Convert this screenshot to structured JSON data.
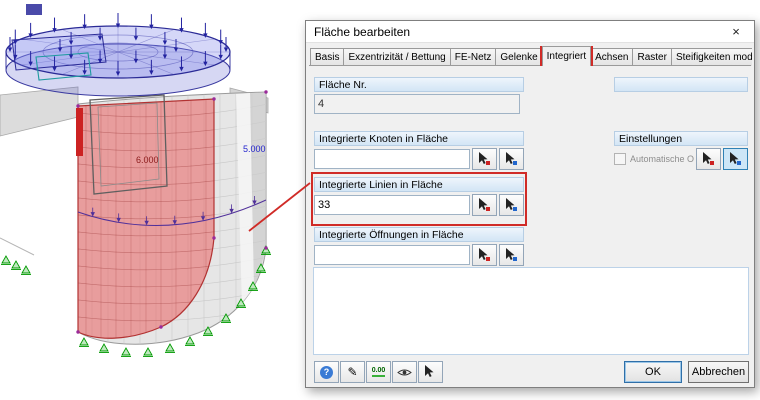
{
  "window": {
    "title": "Fläche bearbeiten",
    "close_glyph": "×"
  },
  "tabs": [
    "Basis",
    "Exzentrizität / Bettung",
    "FE-Netz",
    "Gelenke",
    "Integriert",
    "Achsen",
    "Raster",
    "Steifigkeiten modifizieren"
  ],
  "groups": {
    "surface_no": {
      "label": "Fläche Nr.",
      "value": "4"
    },
    "nodes": {
      "label": "Integrierte Knoten in Fläche",
      "value": ""
    },
    "lines": {
      "label": "Integrierte Linien in Fläche",
      "value": "33"
    },
    "openings": {
      "label": "Integrierte Öffnungen in Fläche",
      "value": ""
    },
    "settings": {
      "label": "Einstellungen",
      "auto_detection_label": "Automatische Objekterkennung",
      "auto_detection_checked": false
    }
  },
  "footer": {
    "ok": "OK",
    "cancel": "Abbrechen",
    "decimals_label": "0.00",
    "help_glyph": "?",
    "edit_glyph": "✎"
  },
  "model": {
    "dim_6": "6.000",
    "dim_5": "5.000"
  },
  "annotation_color": "#d02b27",
  "status_colors": {
    "selected_surface": "#e96060",
    "support_green": "#009900",
    "load_blue": "#2323a0"
  }
}
